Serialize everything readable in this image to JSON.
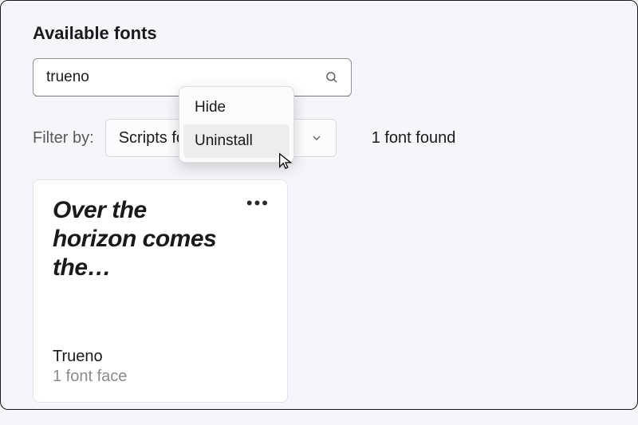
{
  "heading": "Available fonts",
  "search": {
    "value": "trueno"
  },
  "filter": {
    "label": "Filter by:",
    "selected": "Scripts for"
  },
  "result_count": "1 font found",
  "context_menu": {
    "items": [
      "Hide",
      "Uninstall"
    ]
  },
  "card": {
    "preview_text": "Over the horizon comes the…",
    "name": "Trueno",
    "faces": "1 font face"
  }
}
